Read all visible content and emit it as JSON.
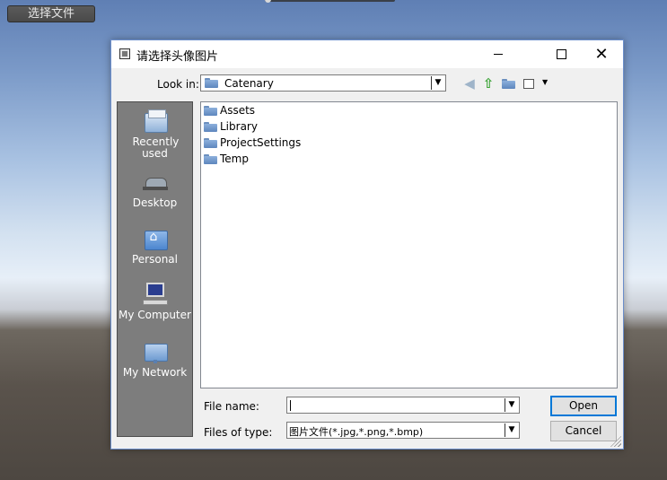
{
  "game": {
    "choose_file_button": "选择文件"
  },
  "dialog": {
    "title": "请选择头像图片",
    "look_in_label": "Look in:",
    "look_in_value": "Catenary",
    "places": [
      {
        "label": "Recently used",
        "icon": "recent-folder-icon"
      },
      {
        "label": "Desktop",
        "icon": "desktop-icon"
      },
      {
        "label": "Personal",
        "icon": "home-folder-icon"
      },
      {
        "label": "My Computer",
        "icon": "computer-icon"
      },
      {
        "label": "My Network",
        "icon": "network-folder-icon"
      }
    ],
    "files": [
      {
        "name": "Assets"
      },
      {
        "name": "Library"
      },
      {
        "name": "ProjectSettings"
      },
      {
        "name": "Temp"
      }
    ],
    "file_name_label": "File name:",
    "file_name_value": "",
    "file_type_label": "Files of type:",
    "file_type_value": "图片文件(*.jpg,*.png,*.bmp)",
    "open_label": "Open",
    "cancel_label": "Cancel"
  }
}
